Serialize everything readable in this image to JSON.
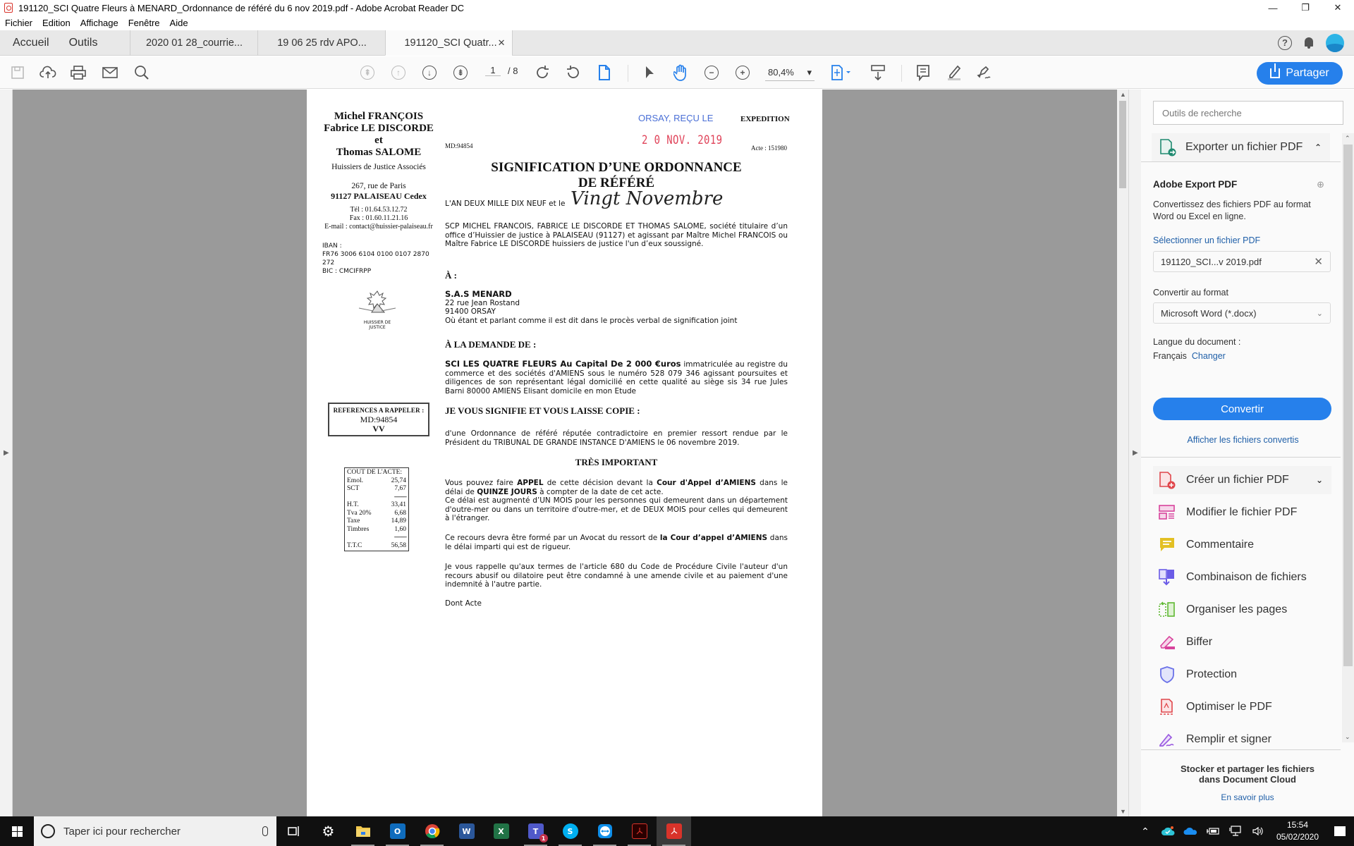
{
  "window": {
    "title": "191120_SCI Quatre Fleurs à MENARD_Ordonnance de référé du 6 nov 2019.pdf - Adobe Acrobat Reader DC",
    "minimize": "—",
    "maximize": "❐",
    "close": "✕"
  },
  "menu": [
    "Fichier",
    "Edition",
    "Affichage",
    "Fenêtre",
    "Aide"
  ],
  "nav": {
    "home": "Accueil",
    "tools": "Outils"
  },
  "tabs": [
    {
      "label": "2020 01 28_courrie..."
    },
    {
      "label": "19 06 25 rdv APO..."
    },
    {
      "label": "191120_SCI Quatr...",
      "close": "✕"
    }
  ],
  "header_icons": {
    "help": "?"
  },
  "toolbar": {
    "page_current": "1",
    "page_total": "/ 8",
    "zoom": "80,4%",
    "zoom_caret": "▾",
    "share_label": "Partager"
  },
  "document": {
    "firm_names": [
      "Michel FRANÇOIS",
      "Fabrice LE DISCORDE",
      "et",
      "Thomas SALOME"
    ],
    "firm_role": "Huissiers de Justice Associés",
    "firm_street": "267, rue de Paris",
    "firm_city": "91127 PALAISEAU Cedex",
    "firm_tel": "Tél : 01.64.53.12.72",
    "firm_fax": "Fax : 01.60.11.21.16",
    "firm_email": "E-mail : contact@huissier-palaiseau.fr",
    "iban_label": "IBAN :",
    "iban_line1": "FR76 3006 6104 0100 0107 2870",
    "iban_line2": "272",
    "bic": "BIC : CMCIFRPP",
    "logo_caption": "HUISSIER DE JUSTICE",
    "refs_title": "REFERENCES A RAPPELER :",
    "refs_md": "MD:94854",
    "refs_vv": "VV",
    "cost": {
      "title": "COUT DE L'ACTE:",
      "rows": [
        {
          "label": "Emol.",
          "value": "25,74"
        },
        {
          "label": "SCT",
          "value": "7,67"
        },
        {
          "label": "",
          "value": "--------"
        },
        {
          "label": "H.T.",
          "value": "33,41"
        },
        {
          "label": "Tva 20%",
          "value": "6,68"
        },
        {
          "label": "Taxe",
          "value": "14,89"
        },
        {
          "label": "Timbres",
          "value": "1,60"
        },
        {
          "label": "",
          "value": "--------"
        },
        {
          "label": "T.T.C",
          "value": "56,58"
        }
      ]
    },
    "stamp_received": "ORSAY, REÇU LE",
    "stamp_date": "2 0 NOV. 2019",
    "expedition": "EXPEDITION",
    "md_ref": "MD:94854",
    "acte_ref": "Acte : 151980",
    "title_line1": "SIGNIFICATION D’UNE ORDONNANCE",
    "title_line2": "DE RÉFÉRÉ",
    "date_prefix": "L'AN DEUX MILLE DIX NEUF et le",
    "date_handwritten": "Vingt Novembre",
    "intro": "SCP MICHEL FRANCOIS, FABRICE LE DISCORDE ET THOMAS SALOME, société titulaire d’un office d’Huissier de justice à PALAISEAU (91127) et agissant par Maître Michel FRANCOIS ou Maître Fabrice LE DISCORDE huissiers de justice l'un d’eux soussigné.",
    "to_heading": "À :",
    "recipient_name": "S.A.S MENARD",
    "recipient_street": "22 rue Jean Rostand",
    "recipient_city": "91400 ORSAY",
    "recipient_note": "Où étant et parlant comme il est dit dans le procès verbal de signification joint",
    "request_heading": "À LA DEMANDE DE :",
    "requester_bold": "SCI LES QUATRE FLEURS Au Capital De 2 000 €uros",
    "requester_text": " immatriculée au registre du commerce et des sociétés d'AMIENS sous le numéro 528 079 346 agissant poursuites et diligences de son représentant légal domicilié en cette qualité au siège sis  34 rue Jules Barni 80000 AMIENS Elisant domicile en mon Etude",
    "signify_heading": "JE VOUS SIGNIFIE ET VOUS LAISSE COPIE :",
    "signify_text": "d'une Ordonnance de référé réputée contradictoire en premier ressort rendue par le Président du TRIBUNAL DE GRANDE INSTANCE D'AMIENS le 06 novembre 2019.",
    "important_heading": "TRÈS IMPORTANT",
    "appeal_p1_a": "Vous pouvez faire ",
    "appeal_p1_b": "APPEL",
    "appeal_p1_c": " de cette décision devant la ",
    "appeal_p1_d": "Cour d'Appel d’AMIENS",
    "appeal_p1_e": "  dans le délai de ",
    "appeal_p1_f": "QUINZE JOURS",
    "appeal_p1_g": " à compter de la date de cet acte.",
    "appeal_p2": "Ce délai est augmenté d’UN MOIS pour les personnes qui demeurent dans un département d'outre-mer ou dans un territoire d'outre-mer, et de DEUX MOIS pour celles qui demeurent à l'étranger.",
    "recourse_a": "Ce recours devra être formé par un Avocat du ressort de ",
    "recourse_b": "la  Cour d’appel d’AMIENS",
    "recourse_c": " dans le délai imparti qui est de rigueur.",
    "reminder": "Je vous rappelle qu'aux termes de l'article 680 du Code de Procédure Civile l'auteur d'un recours abusif ou dilatoire peut être condamné à une amende civile et au paiement d'une indemnité à l'autre partie.",
    "closing": "Dont Acte"
  },
  "side_panel": {
    "search_placeholder": "Outils de recherche",
    "export_section": "Exporter un fichier PDF",
    "export_title": "Adobe Export PDF",
    "export_desc": "Convertissez des fichiers PDF au format Word ou Excel en ligne.",
    "select_file_link": "Sélectionner un fichier PDF",
    "selected_file": "191120_SCI...v 2019.pdf",
    "convert_to_label": "Convertir au format",
    "format_value": "Microsoft Word (*.docx)",
    "language_label": "Langue du document :",
    "language_value": "Français",
    "change_link": "Changer",
    "convert_button": "Convertir",
    "converted_link": "Afficher les fichiers convertis",
    "tools": [
      {
        "label": "Créer un fichier PDF",
        "icon": "create-pdf-icon",
        "color": "#e0474c"
      },
      {
        "label": "Modifier le fichier PDF",
        "icon": "edit-pdf-icon",
        "color": "#d8439c"
      },
      {
        "label": "Commentaire",
        "icon": "comment-icon",
        "color": "#e3c024"
      },
      {
        "label": "Combinaison de fichiers",
        "icon": "combine-files-icon",
        "color": "#6b5ce7"
      },
      {
        "label": "Organiser les pages",
        "icon": "organize-pages-icon",
        "color": "#5fb832"
      },
      {
        "label": "Biffer",
        "icon": "redact-icon",
        "color": "#d8439c"
      },
      {
        "label": "Protection",
        "icon": "shield-icon",
        "color": "#6b72e8"
      },
      {
        "label": "Optimiser le PDF",
        "icon": "optimize-pdf-icon",
        "color": "#e0474c"
      },
      {
        "label": "Remplir et signer",
        "icon": "fill-sign-icon",
        "color": "#9b5ce0"
      }
    ],
    "footer_text": "Stocker et partager les fichiers dans Document Cloud",
    "footer_link": "En savoir plus"
  },
  "taskbar": {
    "search_placeholder": "Taper ici pour rechercher",
    "apps": [
      {
        "name": "task-view",
        "label": ""
      },
      {
        "name": "settings",
        "label": "⚙"
      },
      {
        "name": "file-explorer",
        "label": ""
      },
      {
        "name": "outlook",
        "label": "O"
      },
      {
        "name": "chrome",
        "label": ""
      },
      {
        "name": "word",
        "label": "W"
      },
      {
        "name": "excel",
        "label": "X"
      },
      {
        "name": "teams",
        "label": "T"
      },
      {
        "name": "skype",
        "label": "S"
      },
      {
        "name": "teamviewer",
        "label": ""
      },
      {
        "name": "acrobat-dc",
        "label": ""
      },
      {
        "name": "acrobat-reader",
        "label": ""
      }
    ],
    "teams_badge": "1",
    "time": "15:54",
    "date": "05/02/2020"
  },
  "colors": {
    "accent": "#2680eb",
    "stamp_blue": "#4a6fd6",
    "stamp_red": "#e0445a",
    "link": "#1f5fa8"
  }
}
